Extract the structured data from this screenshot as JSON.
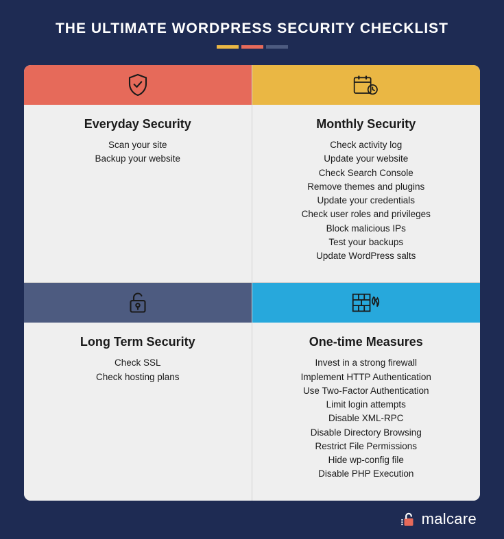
{
  "title": "THE ULTIMATE WORDPRESS SECURITY CHECKLIST",
  "brand": "malcare",
  "cards": [
    {
      "heading": "Everyday Security",
      "items": [
        "Scan your site",
        "Backup your website"
      ]
    },
    {
      "heading": "Monthly Security",
      "items": [
        "Check activity log",
        "Update your website",
        "Check Search Console",
        "Remove themes and plugins",
        "Update your credentials",
        "Check user roles and privileges",
        "Block malicious IPs",
        "Test your backups",
        "Update WordPress salts"
      ]
    },
    {
      "heading": "Long Term Security",
      "items": [
        "Check SSL",
        "Check hosting plans"
      ]
    },
    {
      "heading": "One-time Measures",
      "items": [
        "Invest in a strong firewall",
        "Implement HTTP Authentication",
        "Use Two-Factor Authentication",
        "Limit login attempts",
        "Disable XML-RPC",
        "Disable Directory Browsing",
        "Restrict File Permissions",
        "Hide wp-config file",
        "Disable PHP Execution"
      ]
    }
  ]
}
